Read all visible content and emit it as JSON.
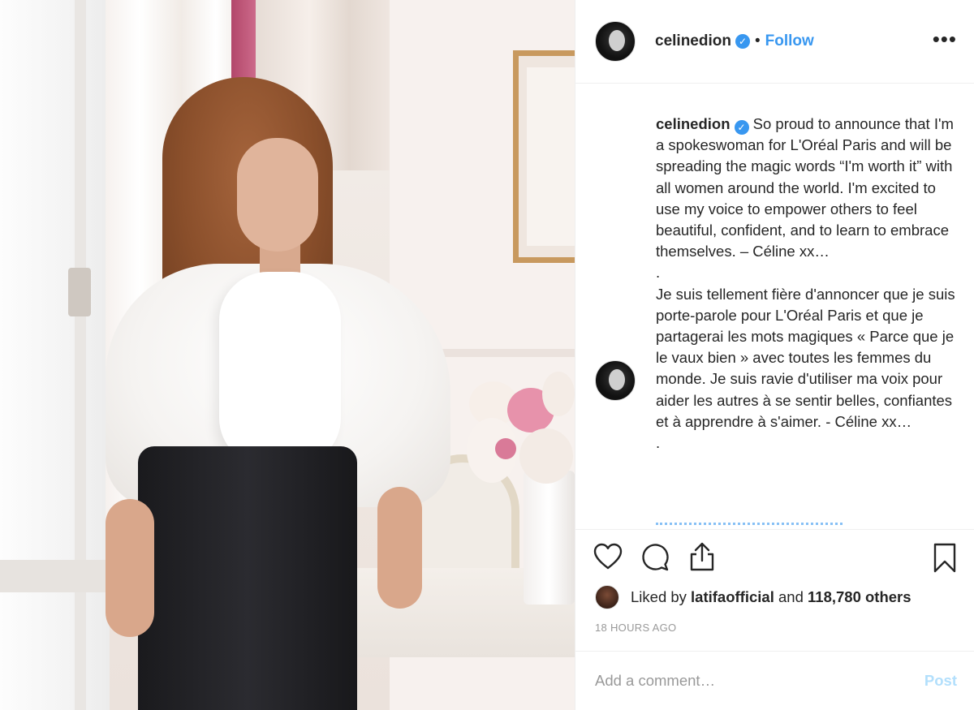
{
  "post": {
    "username": "celinedion",
    "verified_icon": "verified-badge-icon",
    "separator": "•",
    "follow_label": "Follow",
    "more_label": "•••"
  },
  "caption": {
    "username": "celinedion",
    "english": "So proud to announce that I'm a spokeswoman for L'Oréal Paris and will be spreading the magic words “I'm worth it” with all women around the world. I'm excited to use my voice to empower others to feel beautiful, confident, and to learn to embrace themselves. – Céline xx…",
    "dot1": ".",
    "french": "Je suis tellement fière d'annoncer que je suis porte-parole pour L'Oréal Paris et que je partagerai les mots magiques « Parce que je le vaux bien » avec toutes les femmes du monde. Je suis ravie d'utiliser ma voix pour aider les autres à se sentir belles, confiantes et à apprendre à s'aimer. - Céline xx…",
    "dot2": "."
  },
  "likes": {
    "prefix": "Liked by",
    "user": "latifaofficial",
    "middle": "and",
    "count": "118,780 others"
  },
  "timestamp": "18 HOURS AGO",
  "comment": {
    "placeholder": "Add a comment…",
    "post_label": "Post"
  },
  "colors": {
    "accent": "#3897f0",
    "post_disabled": "#b2dffc",
    "muted": "#999999",
    "text": "#262626"
  }
}
